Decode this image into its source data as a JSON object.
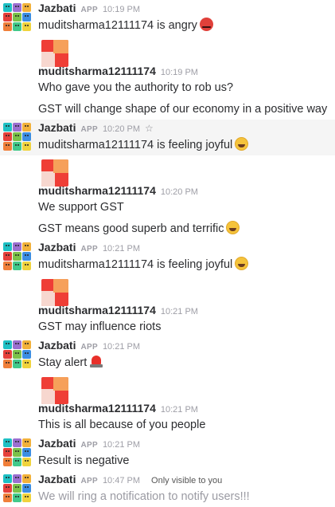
{
  "messages": [
    {
      "name": "Jazbati",
      "badge": "APP",
      "time": "10:19 PM",
      "lines": [
        "muditsharma12111174 is angry"
      ],
      "emoji": "angry-face"
    },
    {
      "name": "muditsharma12111174",
      "time": "10:19 PM",
      "lines": [
        "Who gave you the authority to rob us?",
        "GST will change shape of our economy in a positive way"
      ]
    },
    {
      "name": "Jazbati",
      "badge": "APP",
      "time": "10:20 PM",
      "icon": "star-icon",
      "lines": [
        "muditsharma12111174 is feeling joyful"
      ],
      "emoji": "grinning-face"
    },
    {
      "name": "muditsharma12111174",
      "time": "10:20 PM",
      "lines": [
        "We support GST",
        "GST means good superb and terrific"
      ],
      "emoji": "grinning-face"
    },
    {
      "name": "Jazbati",
      "badge": "APP",
      "time": "10:21 PM",
      "lines": [
        "muditsharma12111174 is feeling joyful"
      ],
      "emoji": "grinning-face"
    },
    {
      "name": "muditsharma12111174",
      "time": "10:21 PM",
      "lines": [
        "GST may influence riots"
      ]
    },
    {
      "name": "Jazbati",
      "badge": "APP",
      "time": "10:21 PM",
      "lines": [
        "Stay alert"
      ],
      "emoji": "rotating-light"
    },
    {
      "name": "muditsharma12111174",
      "time": "10:21 PM",
      "lines": [
        "This is all because of you people"
      ]
    },
    {
      "name": "Jazbati",
      "badge": "APP",
      "time": "10:21 PM",
      "lines": [
        "Result is negative"
      ]
    },
    {
      "name": "Jazbati",
      "badge": "APP",
      "time": "10:47 PM",
      "visibility": "Only visible to you",
      "lines": [
        "We will ring a notification to notify users!!!"
      ]
    }
  ],
  "colors": {
    "jazbati_tiles": [
      "#1ec0c4",
      "#9b6fd0",
      "#f2b13a",
      "#e6403b",
      "#7bc24a",
      "#3b8ee3",
      "#f07f3a",
      "#42c98a",
      "#f0d33c"
    ],
    "mudit_avatar": "#ef3e36"
  }
}
